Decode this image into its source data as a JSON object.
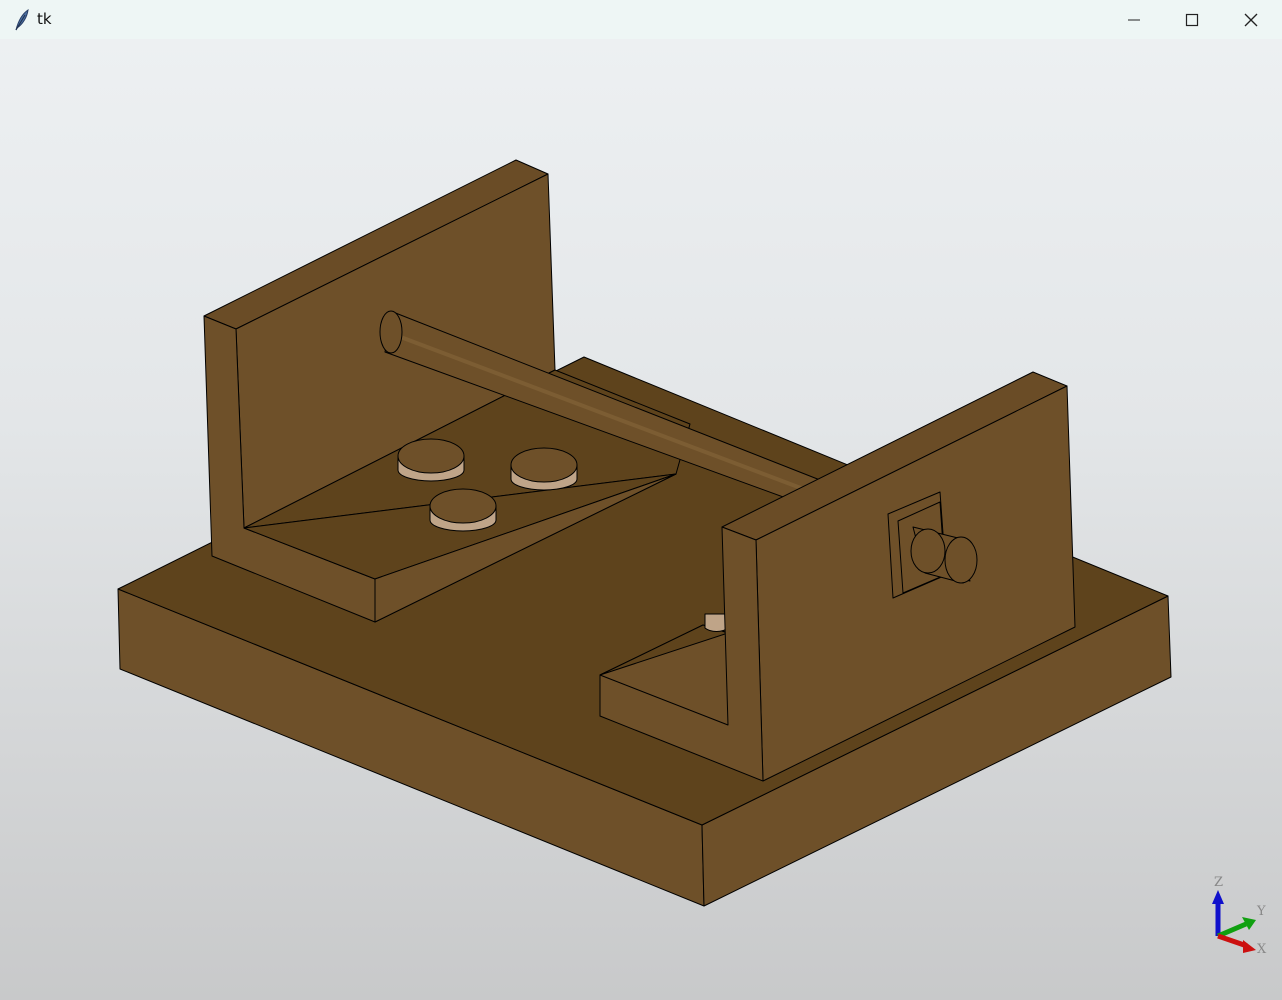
{
  "window": {
    "title": "tk",
    "app_icon": "feather-icon",
    "controls": [
      "minimize-icon",
      "maximize-icon",
      "close-icon"
    ]
  },
  "viewport": {
    "background_top": "#edf0f2",
    "background_bottom": "#c8c9ca",
    "model_color": "#6e5029",
    "model_shade": "#5e431c",
    "edge_color": "#000000"
  },
  "triad": {
    "z_label": "Z",
    "y_label": "Y",
    "x_label": "X",
    "z_color": "#1010cc",
    "y_color": "#10a010",
    "x_color": "#cc1010"
  }
}
